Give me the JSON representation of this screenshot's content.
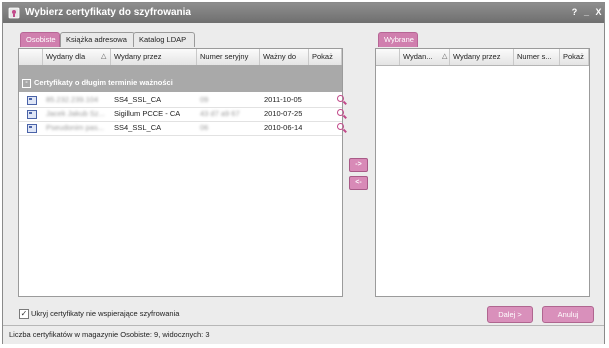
{
  "window": {
    "title": "Wybierz certyfikaty do szyfrowania",
    "help_icon": "?",
    "minimize_icon": "_",
    "close_icon": "X"
  },
  "left_tabs": [
    {
      "label": "Osobiste",
      "active": true
    },
    {
      "label": "Książka adresowa",
      "active": false
    },
    {
      "label": "Katalog LDAP",
      "active": false
    }
  ],
  "left_table": {
    "columns": [
      "Wydany dla",
      "Wydany przez",
      "Numer seryjny",
      "Ważny do",
      "Pokaż"
    ],
    "group_label": "Certyfikaty o długim terminie ważności",
    "rows": [
      {
        "issued_to": "85.232.239.104",
        "issued_by": "SS4_SSL_CA",
        "serial": "09",
        "valid_to": "2011-10-05",
        "icon": "magnifier-icon"
      },
      {
        "issued_to": "Jacek Jakub Sz...",
        "issued_by": "Sigillum PCCE - CA",
        "serial": "43 d7 a9 67",
        "valid_to": "2010-07-25",
        "icon": "magnifier-icon"
      },
      {
        "issued_to": "Pseudonim pas...",
        "issued_by": "SS4_SSL_CA",
        "serial": "06",
        "valid_to": "2010-06-14",
        "icon": "magnifier-icon"
      }
    ]
  },
  "right_tabs": [
    {
      "label": "Wybrane",
      "active": true
    }
  ],
  "right_table": {
    "columns": [
      "Wydan...",
      "Wydany przez",
      "Numer s...",
      "Pokaż"
    ]
  },
  "move_buttons": {
    "add": "->",
    "remove": "<-"
  },
  "checkbox": {
    "label": "Ukryj certyfikaty nie wspierające szyfrowania",
    "checked": true
  },
  "buttons": {
    "next": "Dalej >",
    "cancel": "Anuluj"
  },
  "status": "Liczba  certyfikatów w magazynie Osobiste: 9, widocznych: 3",
  "colors": {
    "accent": "#d07fae",
    "titlebar": "#7f7f7f",
    "group": "#a9a9a9"
  }
}
